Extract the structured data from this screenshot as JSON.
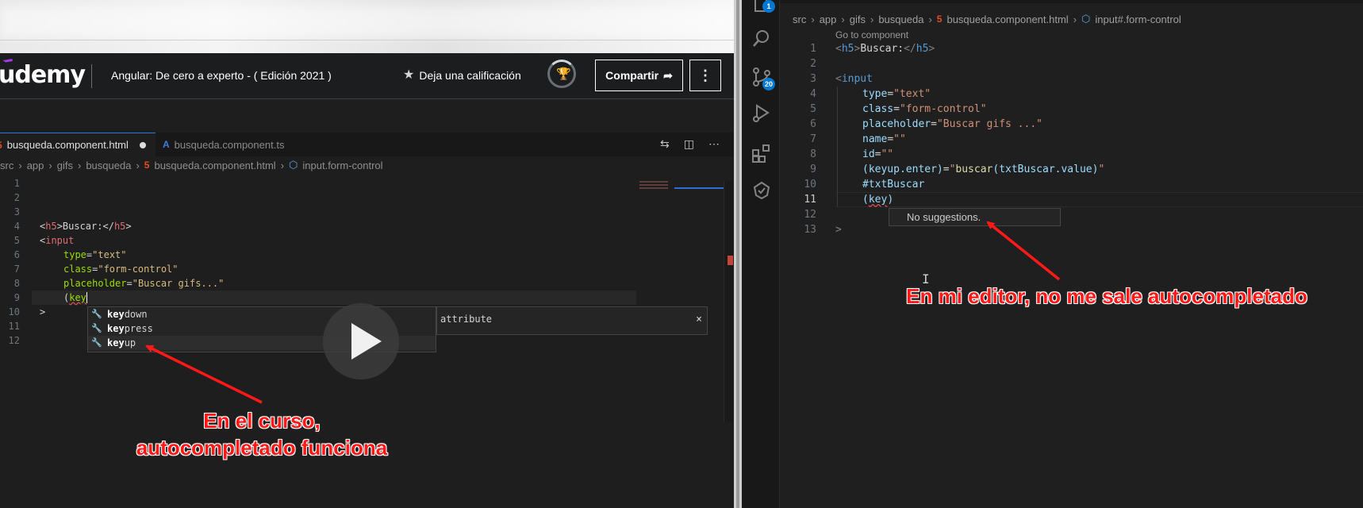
{
  "colors": {
    "annotation": "#ff1818",
    "udemy_purple": "#a435f0",
    "vscode_bg": "#1f1f1f",
    "udemy_bar": "#1c1d1f",
    "badge_blue": "#0078d4"
  },
  "udemy": {
    "logo": "udemy",
    "course_title": "Angular: De cero a experto - ( Edición 2021 )",
    "rate_label": "Deja una calificación",
    "share_label": "Compartir",
    "more_label": "⋮"
  },
  "left_editor": {
    "tabs": [
      {
        "label": "busqueda.component.html",
        "icon": "html5-icon",
        "icon_glyph": "5",
        "dirty": true
      },
      {
        "label": "busqueda.component.ts",
        "icon": "angular-icon",
        "icon_glyph": "A"
      }
    ],
    "breadcrumb": [
      "src",
      "app",
      "gifs",
      "busqueda",
      "busqueda.component.html",
      "input.form-control"
    ],
    "line_numbers": [
      "1",
      "2",
      "3",
      "4",
      "5",
      "6",
      "7",
      "8",
      "9",
      "10",
      "11",
      "12"
    ],
    "code": {
      "l4_open": "<",
      "l4_tag": "h5",
      "l4_mid": ">Buscar:</",
      "l4_close": ">",
      "l5_open": "<",
      "l5_tag": "input",
      "l6_attr": "type",
      "l6_eq": "=",
      "l6_val": "\"text\"",
      "l7_attr": "class",
      "l7_eq": "=",
      "l7_val": "\"form-control\"",
      "l8_attr": "placeholder",
      "l8_eq": "=",
      "l8_val": "\"Buscar gifs...\"",
      "l9_paren": "(",
      "l9_typed": "key",
      "l10": ">"
    },
    "suggestions": [
      {
        "match": "key",
        "rest": "down"
      },
      {
        "match": "key",
        "rest": "press"
      },
      {
        "match": "key",
        "rest": "up"
      }
    ],
    "suggestion_detail": "attribute",
    "detail_close": "×"
  },
  "right_editor": {
    "breadcrumb": [
      "src",
      "app",
      "gifs",
      "busqueda",
      "busqueda.component.html",
      "input#.form-control"
    ],
    "goto_component": "Go to component",
    "activity": {
      "explorer_badge": "1",
      "scm_badge": "20"
    },
    "line_numbers": [
      "1",
      "2",
      "3",
      "4",
      "5",
      "6",
      "7",
      "8",
      "9",
      "10",
      "11",
      "12",
      "13"
    ],
    "active_line": "11",
    "code": {
      "l1_lt": "<",
      "l1_tag": "h5",
      "l1_gt": ">",
      "l1_text": "Buscar:",
      "l1_close_lt": "</",
      "l1_close_tag": "h5",
      "l1_close_gt": ">",
      "l3_lt": "<",
      "l3_tag": "input",
      "l4_attr": "type",
      "l4_eq": "=",
      "l4_val": "\"text\"",
      "l5_attr": "class",
      "l5_eq": "=",
      "l5_val": "\"form-control\"",
      "l6_attr": "placeholder",
      "l6_eq": "=",
      "l6_val": "\"Buscar gifs ...\"",
      "l7_attr": "name",
      "l7_eq": "=",
      "l7_val": "\"\"",
      "l8_attr": "id",
      "l8_eq": "=",
      "l8_val": "\"\"",
      "l9_event": "(keyup.enter)",
      "l9_eq": "=",
      "l9_q1": "\"",
      "l9_fn": "buscar",
      "l9_args": "(txtBuscar.value)",
      "l9_q2": "\"",
      "l10_ref": "#txtBuscar",
      "l11_paren": "(",
      "l11_typed": "key",
      "l11_close": ")",
      "l13": ">"
    },
    "no_suggestions": "No suggestions."
  },
  "annotations": {
    "left_line1": "En el curso,",
    "left_line2": "autocompletado funciona",
    "right": "En mi editor, no me sale autocompletado"
  }
}
